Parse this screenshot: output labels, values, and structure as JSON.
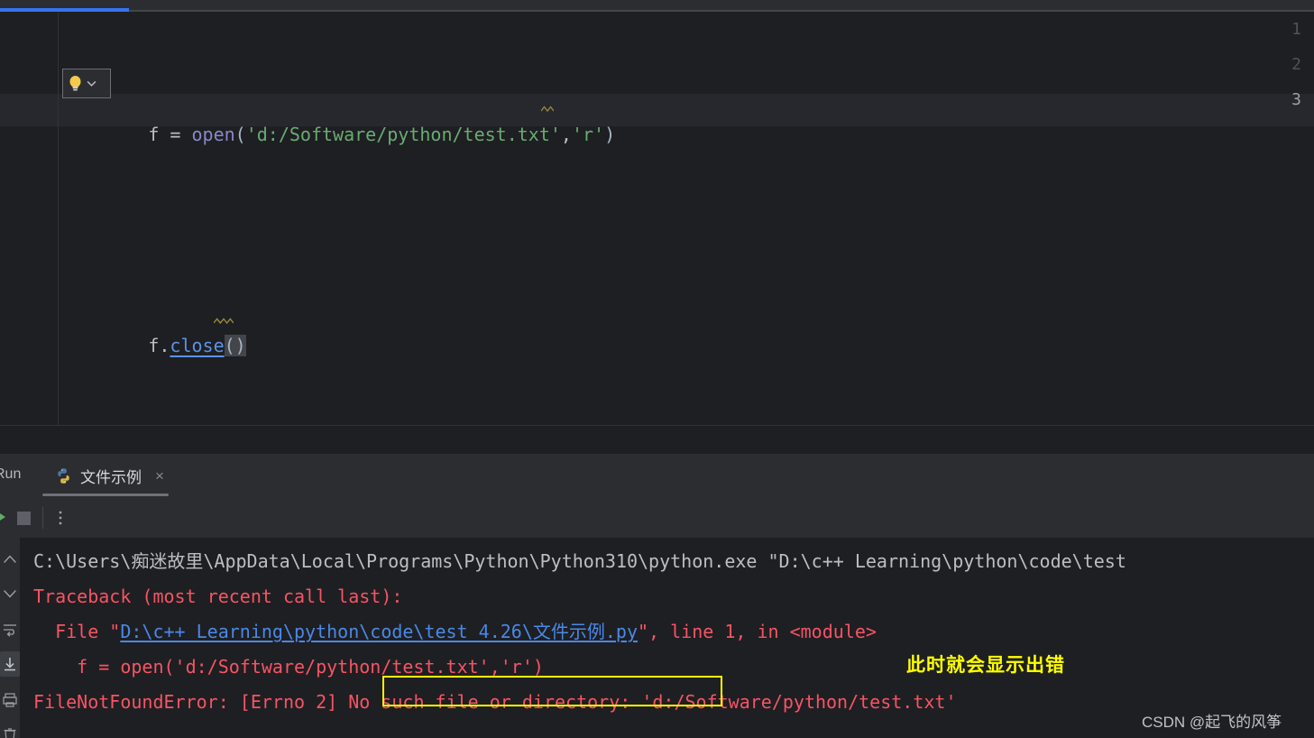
{
  "editor": {
    "progress_visible": true,
    "line_numbers": [
      "1",
      "2",
      "3"
    ],
    "lines": [
      {
        "number": "1",
        "segments": [
          {
            "text": "f = ",
            "kind": "default"
          },
          {
            "text": "open",
            "kind": "func"
          },
          {
            "text": "(",
            "kind": "paren"
          },
          {
            "text": "'d:/Software/python/test.txt'",
            "kind": "string"
          },
          {
            "text": ",",
            "kind": "default"
          },
          {
            "text": "'r'",
            "kind": "string"
          },
          {
            "text": ")",
            "kind": "paren"
          }
        ],
        "plain": "f = open('d:/Software/python/test.txt','r')"
      },
      {
        "number": "2",
        "plain": ""
      },
      {
        "number": "3",
        "segments": [
          {
            "text": "f.",
            "kind": "default"
          },
          {
            "text": "close",
            "kind": "method"
          },
          {
            "text": "()",
            "kind": "paren"
          }
        ],
        "plain": "f.close()"
      }
    ],
    "line1": {
      "assign": "f = ",
      "func": "open",
      "lparen": "(",
      "path_string": "'d:/Software/python/test.txt'",
      "comma": ",",
      "mode_string": "'r'",
      "rparen": ")"
    },
    "line3": {
      "obj": "f.",
      "method": "close",
      "parens": "()"
    },
    "intention": {
      "icon": "lightbulb-icon",
      "chevron": "chevron-down-icon"
    }
  },
  "run_panel": {
    "title": "Run",
    "tab": {
      "label": "文件示例",
      "icon": "python-file-icon",
      "close": "×",
      "active": true
    },
    "toolbar": {
      "rerun": "run-icon",
      "stop": "stop-icon",
      "more": "more-options-icon"
    },
    "side_icons": [
      "scroll-up-icon",
      "scroll-down-icon",
      "soft-wrap-icon",
      "scroll-to-end-icon",
      "print-icon",
      "clear-all-icon"
    ]
  },
  "console": {
    "lines": [
      {
        "id": "command",
        "kind": "cmd",
        "text": "C:\\Users\\痴迷故里\\AppData\\Local\\Programs\\Python\\Python310\\python.exe \"D:\\c++ Learning\\python\\code\\test"
      },
      {
        "id": "traceback-header",
        "kind": "err",
        "text": "Traceback (most recent call last):"
      },
      {
        "id": "file-line",
        "kind": "mixed",
        "prefix": "  File \"",
        "link": "D:\\c++ Learning\\python\\code\\test 4.26\\文件示例.py",
        "suffix": "\", line 1, in <module>"
      },
      {
        "id": "source-line",
        "kind": "err",
        "text": "    f = open('d:/Software/python/test.txt','r')"
      },
      {
        "id": "error-line",
        "kind": "err",
        "part_a": "FileNotFoundError: [Errno 2] ",
        "part_b": "No such file or directory:",
        "part_c": " 'd:/Software/python/test.txt'"
      }
    ]
  },
  "annotations": {
    "highlight_box_target": "No such file or directory:",
    "note": "此时就会显示出错",
    "note_color": "#ffff00",
    "watermark": "CSDN @起飞的风筝"
  },
  "colors": {
    "editor_bg": "#1e1f22",
    "panel_bg": "#2b2d30",
    "string": "#6aab73",
    "function": "#8888c6",
    "method_link": "#5b93e8",
    "error_red": "#f75464",
    "console_link": "#4a88e8",
    "accent_blue": "#3574f0",
    "annotation_yellow": "#ffff00"
  }
}
